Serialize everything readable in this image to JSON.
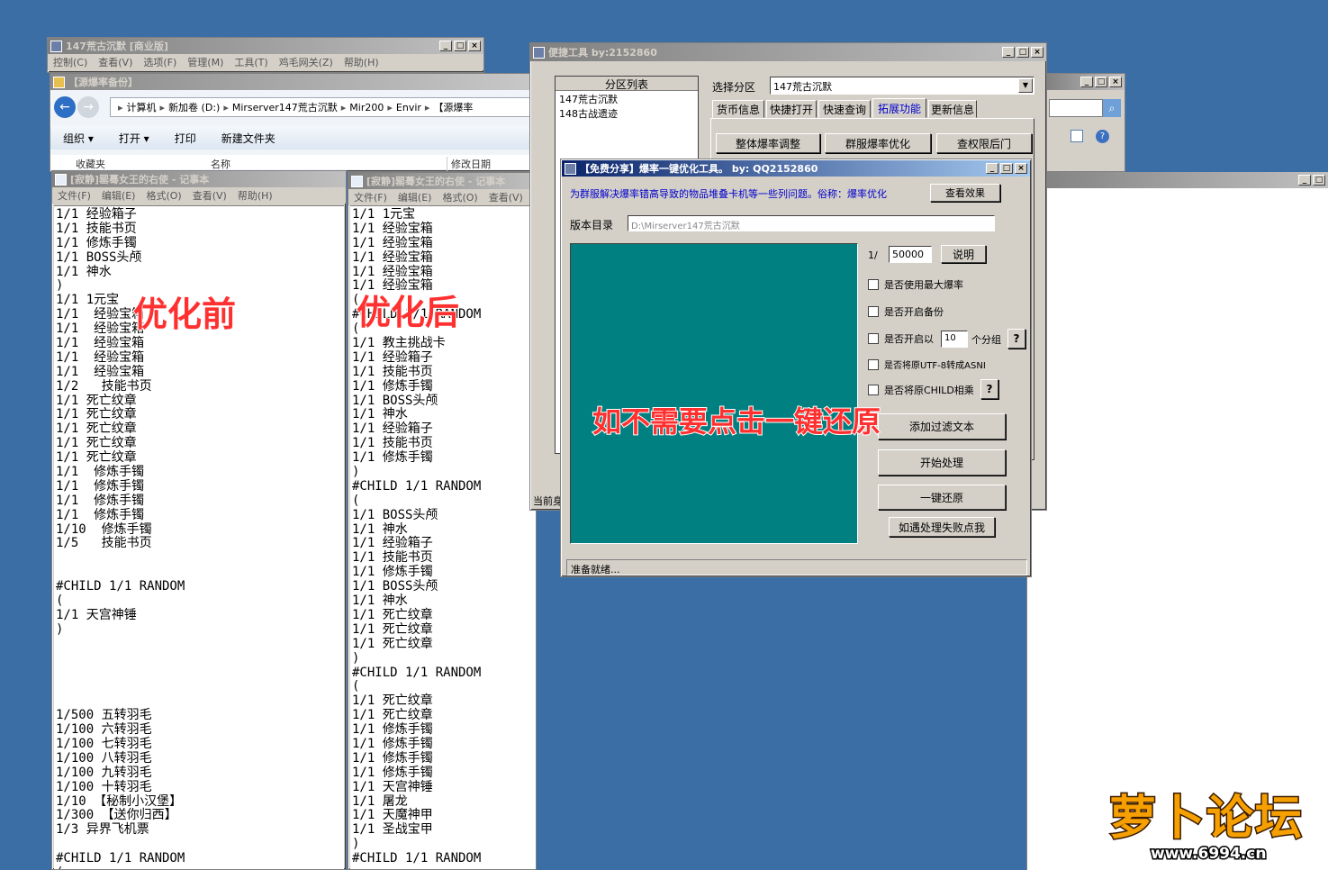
{
  "main_window": {
    "title": "147荒古沉默 [商业版]",
    "menu": [
      "控制(C)",
      "查看(V)",
      "选项(F)",
      "管理(M)",
      "工具(T)",
      "鸡毛网关(Z)",
      "帮助(H)"
    ]
  },
  "explorer": {
    "title": "【源爆率备份】",
    "breadcrumb": [
      "计算机",
      "新加卷 (D:)",
      "Mirserver147荒古沉默",
      "Mir200",
      "Envir",
      "【源爆率"
    ],
    "toolbar": [
      "组织 ▾",
      "打开 ▾",
      "打印",
      "新建文件夹"
    ],
    "columns": [
      "名称",
      "修改日期"
    ],
    "nav_item": "收藏夹"
  },
  "notepad_left": {
    "title": "[寂静]罂蓦女王的右使 - 记事本",
    "menu": [
      "文件(F)",
      "编辑(E)",
      "格式(O)",
      "查看(V)",
      "帮助(H)"
    ],
    "lines": [
      "1/1 经验箱子",
      "1/1 技能书页",
      "1/1 修炼手镯",
      "1/1 BOSS头颅",
      "1/1 神水",
      ")",
      "1/1 1元宝",
      "1/1  经验宝箱",
      "1/1  经验宝箱",
      "1/1  经验宝箱",
      "1/1  经验宝箱",
      "1/1  经验宝箱",
      "1/2   技能书页",
      "1/1 死亡纹章",
      "1/1 死亡纹章",
      "1/1 死亡纹章",
      "1/1 死亡纹章",
      "1/1 死亡纹章",
      "1/1  修炼手镯",
      "1/1  修炼手镯",
      "1/1  修炼手镯",
      "1/1  修炼手镯",
      "1/10  修炼手镯",
      "1/5   技能书页",
      "",
      "",
      "#CHILD 1/1 RANDOM",
      "(",
      "1/1 天宫神锤",
      ")",
      "",
      "",
      "",
      "",
      "",
      "1/500 五转羽毛",
      "1/100 六转羽毛",
      "1/100 七转羽毛",
      "1/100 八转羽毛",
      "1/100 九转羽毛",
      "1/100 十转羽毛",
      "1/10 【秘制小汉堡】",
      "1/300 【送你归西】",
      "1/3 异界飞机票",
      "",
      "#CHILD 1/1 RANDOM",
      "("
    ]
  },
  "notepad_right": {
    "title": "[寂静]罂蓦女王的右使 - 记事本",
    "menu": [
      "文件(F)",
      "编辑(E)",
      "格式(O)",
      "查看(V)"
    ],
    "lines": [
      "1/1 1元宝",
      "1/1 经验宝箱",
      "1/1 经验宝箱",
      "1/1 经验宝箱",
      "1/1 经验宝箱",
      "1/1 经验宝箱",
      "(",
      "#CHILD 1/1 RANDOM",
      "(",
      "1/1 教主挑战卡",
      "1/1 经验箱子",
      "1/1 技能书页",
      "1/1 修炼手镯",
      "1/1 BOSS头颅",
      "1/1 神水",
      "1/1 经验箱子",
      "1/1 技能书页",
      "1/1 修炼手镯",
      ")",
      "#CHILD 1/1 RANDOM",
      "(",
      "1/1 BOSS头颅",
      "1/1 神水",
      "1/1 经验箱子",
      "1/1 技能书页",
      "1/1 修炼手镯",
      "1/1 BOSS头颅",
      "1/1 神水",
      "1/1 死亡纹章",
      "1/1 死亡纹章",
      "1/1 死亡纹章",
      ")",
      "#CHILD 1/1 RANDOM",
      "(",
      "1/1 死亡纹章",
      "1/1 死亡纹章",
      "1/1 修炼手镯",
      "1/1 修炼手镯",
      "1/1 修炼手镯",
      "1/1 修炼手镯",
      "1/1 天宫神锤",
      "1/1 屠龙",
      "1/1 天魔神甲",
      "1/1 圣战宝甲",
      ")",
      "#CHILD 1/1 RANDOM"
    ]
  },
  "quick_tool": {
    "title": "便捷工具   by:2152860",
    "list_header": "分区列表",
    "list_items": [
      "147荒古沉默",
      "148古战遗迹"
    ],
    "select_label": "选择分区",
    "select_value": "147荒古沉默",
    "tabs": [
      "货币信息",
      "快捷打开",
      "快速查询",
      "拓展功能",
      "更新信息"
    ],
    "buttons": [
      "整体爆率调整",
      "群服爆率优化",
      "查权限后门"
    ],
    "status_partial": "当前身"
  },
  "optimizer": {
    "title": "【免费分享】爆率一键优化工具。   by: QQ2152860",
    "description": "为群服解决爆率错高导致的物品堆叠卡机等一些列问题。俗称：爆率优化",
    "view_button": "查看效果",
    "dir_label": "版本目录",
    "dir_value": "D:\\Mirserver147荒古沉默",
    "ratio_prefix": "1/",
    "ratio_value": "50000",
    "explain_button": "说明",
    "checkboxes": [
      "是否使用最大爆率",
      "是否开启备份"
    ],
    "group_label_a": "是否开启以",
    "group_value": "10",
    "group_label_b": "个分组",
    "help_q": "?",
    "utf8_check": "是否将原UTF-8转成ASNI",
    "child_check": "是否将原CHILD相乘",
    "btn_filter": "添加过滤文本",
    "btn_process": "开始处理",
    "btn_restore": "一键还原",
    "btn_fail": "如遇处理失败点我",
    "status": "准备就绪..."
  },
  "annotations": {
    "before": "优化前",
    "after": "优化后",
    "restore_hint": "如不需要点击一键还原"
  },
  "watermark": {
    "text": "萝卜论坛",
    "url": "www.6994.cn"
  },
  "colors": {
    "desktop": "#3a6ea5",
    "canvas_teal": "#008080",
    "annotation_red": "#ff3030"
  }
}
